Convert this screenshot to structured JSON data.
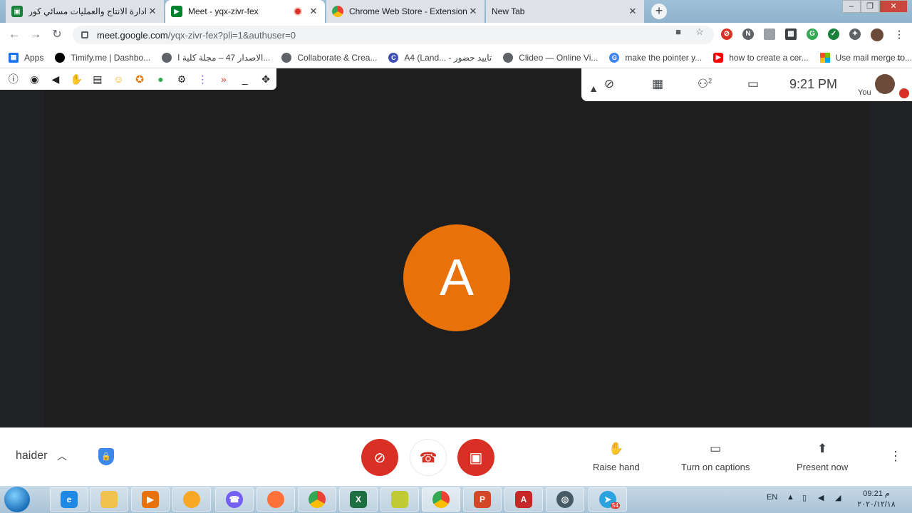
{
  "browser": {
    "tabs": [
      {
        "title": "ادارة الانتاج والعمليات مسائي كورس اول -",
        "favicon_color": "#188038",
        "active": false
      },
      {
        "title": "Meet - yqx-zivr-fex",
        "favicon_color": "#00832d",
        "active": true,
        "recording": true
      },
      {
        "title": "Chrome Web Store - Extensions",
        "favicon_color": "#ea4335",
        "active": false
      },
      {
        "title": "New Tab",
        "favicon_color": "",
        "active": false
      }
    ],
    "tab_close_glyph": "✕",
    "new_tab_glyph": "+",
    "url_host": "meet.google.com",
    "url_path": "/yqx-zivr-fex?pli=1&authuser=0",
    "bookmarks": [
      {
        "label": "Apps",
        "icon": "apps-grid-icon",
        "color": "#1a73e8"
      },
      {
        "label": "Timify.me | Dashbo...",
        "icon": "timify-icon",
        "color": "#000000"
      },
      {
        "label": "الاصدار 47 – مجلة كلية ا...",
        "icon": "globe-icon",
        "color": "#5f6368"
      },
      {
        "label": "Collaborate & Crea...",
        "icon": "globe-icon",
        "color": "#5f6368"
      },
      {
        "label": "A4 (Land... - تاييد حضور",
        "icon": "canva-icon",
        "color": "#3f51b5"
      },
      {
        "label": "Clideo — Online Vi...",
        "icon": "globe-icon",
        "color": "#5f6368"
      },
      {
        "label": "make the pointer y...",
        "icon": "google-icon",
        "color": "#4285f4"
      },
      {
        "label": "how to create a cer...",
        "icon": "youtube-icon",
        "color": "#ff0000"
      },
      {
        "label": "Use mail merge to...",
        "icon": "microsoft-icon",
        "color": "#f25022"
      }
    ]
  },
  "meet": {
    "participant_initial": "A",
    "avatar_color": "#e8710a",
    "time": "9:21 PM",
    "participants_count": "2",
    "you_label": "You",
    "user_name": "haider",
    "actions": {
      "raise_hand": "Raise hand",
      "captions": "Turn on captions",
      "present": "Present now"
    },
    "control_color": "#d93025"
  },
  "taskbar": {
    "language": "EN",
    "clock_time": "09:21 م",
    "clock_date": "٢٠٢٠/١٢/١٨",
    "telegram_badge": "54"
  }
}
